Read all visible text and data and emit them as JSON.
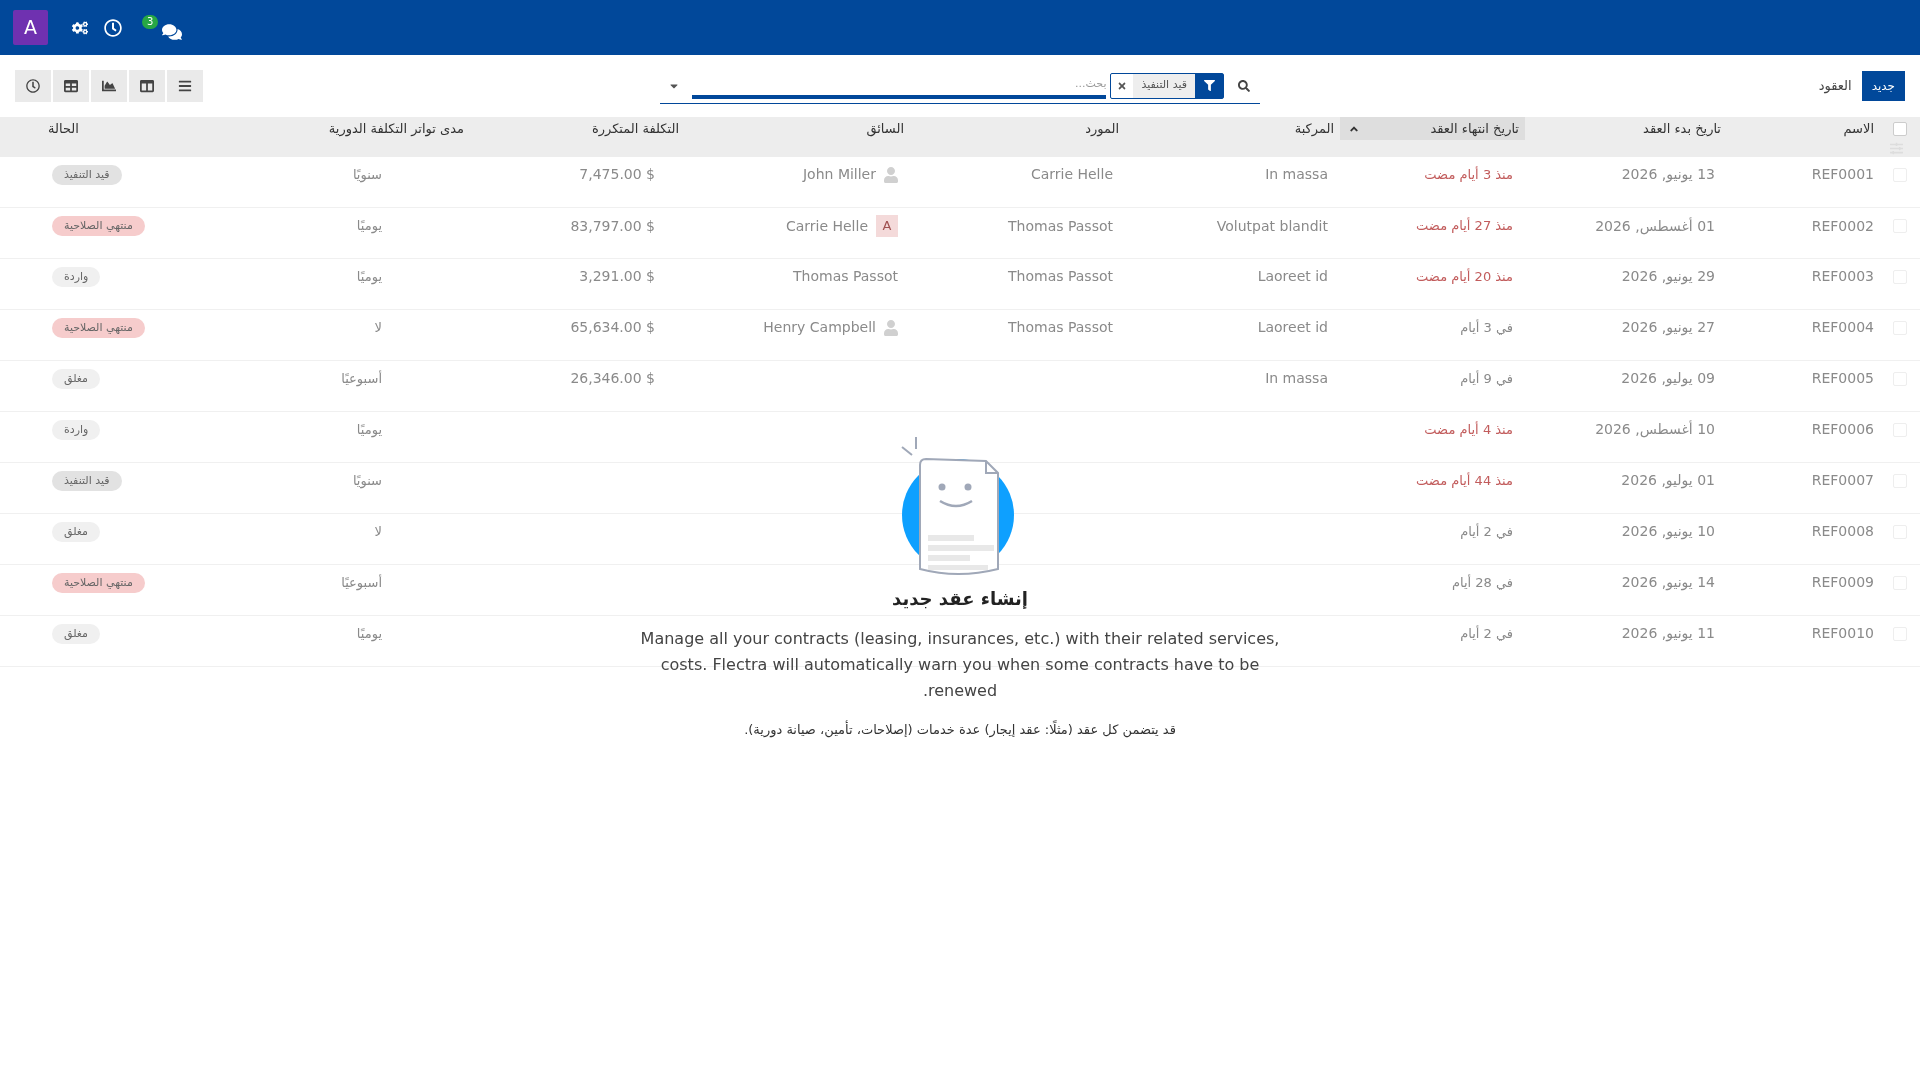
{
  "topbar": {
    "avatar": "A",
    "messages_badge": "3"
  },
  "control_panel": {
    "create_button": "جديد",
    "breadcrumb": "العقود",
    "search": {
      "placeholder": "بحث...",
      "facets": [
        {
          "label": "قيد التنفيذ"
        }
      ]
    },
    "views": [
      {
        "kind": "activity"
      },
      {
        "kind": "pivot"
      },
      {
        "kind": "graph"
      },
      {
        "kind": "kanban"
      },
      {
        "kind": "list"
      }
    ]
  },
  "table": {
    "header_checked": false,
    "columns": [
      {
        "label": "الاسم",
        "sorted": false
      },
      {
        "label": "تاريخ بدء العقد",
        "sorted": false
      },
      {
        "label": "تاريخ انتهاء العقد",
        "sorted": true
      },
      {
        "label": "المركبة",
        "sorted": false
      },
      {
        "label": "المورد",
        "sorted": false
      },
      {
        "label": "السائق",
        "sorted": false
      },
      {
        "label": "التكلفة المتكررة",
        "sorted": false
      },
      {
        "label": "مدى تواتر التكلفة الدورية",
        "sorted": false
      },
      {
        "label": "الحالة",
        "sorted": false
      }
    ],
    "rows": [
      {
        "checked": false,
        "name": "REF0001",
        "start_date": "13 يونيو, 2026",
        "end_date": "منذ 3 أيام مضت",
        "overdue": true,
        "vehicle": "In massa",
        "supplier": "Carrie Helle",
        "driver": "John Miller",
        "driver_avatar": {
          "kind": "silhouette"
        },
        "cost": "$ 7,475.00",
        "frequency": "سنويًا",
        "status": "قيد التنفيذ",
        "color": "#e2e2e2"
      },
      {
        "checked": false,
        "name": "REF0002",
        "start_date": "01 أغسطس, 2026",
        "end_date": "منذ 27 أيام مضت",
        "overdue": true,
        "vehicle": "Volutpat blandit",
        "supplier": "Thomas Passot",
        "driver": "Carrie Helle",
        "driver_avatar": {
          "kind": "letter",
          "text": "A"
        },
        "cost": "$ 83,797.00",
        "frequency": "يوميًا",
        "status": "منتهي الصلاحية",
        "color": "#f6cccc"
      },
      {
        "checked": false,
        "name": "REF0003",
        "start_date": "29 يونيو, 2026",
        "end_date": "منذ 20 أيام مضت",
        "overdue": true,
        "vehicle": "Laoreet id",
        "supplier": "Thomas Passot",
        "driver": "Thomas Passot",
        "cost": "$ 3,291.00",
        "frequency": "يوميًا",
        "status": "واردة",
        "color": "#f0f0f0"
      },
      {
        "checked": false,
        "name": "REF0004",
        "start_date": "27 يونيو, 2026",
        "end_date": "في 3 أيام",
        "overdue": false,
        "vehicle": "Laoreet id",
        "supplier": "Thomas Passot",
        "driver": "Henry Campbell",
        "driver_avatar": {
          "kind": "silhouette"
        },
        "cost": "$ 65,634.00",
        "frequency": "لا",
        "status": "منتهي الصلاحية",
        "color": "#f6cccc"
      },
      {
        "checked": false,
        "name": "REF0005",
        "start_date": "09 يوليو, 2026",
        "end_date": "في 9 أيام",
        "overdue": false,
        "vehicle": "In massa",
        "cost": "$ 26,346.00",
        "frequency": "أسبوعيًا",
        "status": "مغلق",
        "color": "#f0f0f0"
      },
      {
        "checked": false,
        "name": "REF0006",
        "start_date": "10 أغسطس, 2026",
        "end_date": "منذ 4 أيام مضت",
        "overdue": true,
        "frequency": "يوميًا",
        "status": "واردة",
        "color": "#f0f0f0"
      },
      {
        "checked": false,
        "name": "REF0007",
        "start_date": "01 يوليو, 2026",
        "end_date": "منذ 44 أيام مضت",
        "overdue": true,
        "frequency": "سنويًا",
        "status": "قيد التنفيذ",
        "color": "#e2e2e2"
      },
      {
        "checked": false,
        "name": "REF0008",
        "start_date": "10 يونيو, 2026",
        "end_date": "في 2 أيام",
        "overdue": false,
        "frequency": "لا",
        "status": "مغلق",
        "color": "#f0f0f0"
      },
      {
        "checked": false,
        "name": "REF0009",
        "start_date": "14 يونيو, 2026",
        "end_date": "في 28 أيام",
        "overdue": false,
        "frequency": "أسبوعيًا",
        "status": "منتهي الصلاحية",
        "color": "#f6cccc"
      },
      {
        "checked": false,
        "name": "REF0010",
        "start_date": "11 يونيو, 2026",
        "end_date": "في 2 أيام",
        "overdue": false,
        "frequency": "يوميًا",
        "status": "مغلق",
        "color": "#f0f0f0"
      }
    ]
  },
  "empty_state": {
    "title": "إنشاء عقد جديد",
    "description": "Manage all your contracts (leasing, insurances, etc.) with their related services, costs. Flectra will automatically warn you when some contracts have to be renewed.",
    "note": "قد يتضمن كل عقد (مثلًا: عقد إيجار) عدة خدمات (إصلاحات، تأمين، صيانة دورية)."
  }
}
